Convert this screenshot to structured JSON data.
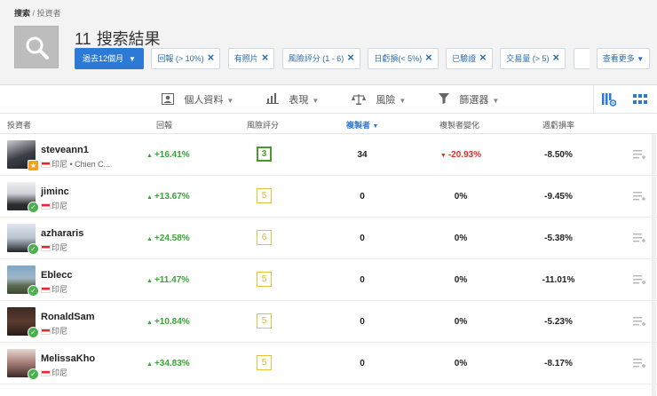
{
  "breadcrumb": {
    "root": "搜索",
    "separator": "/",
    "current": "投資者"
  },
  "results": {
    "count": "11",
    "label": "搜索結果"
  },
  "filters": {
    "period": "過去12個月",
    "chips": [
      "回報 (> 10%)",
      "有照片",
      "風險評分 (1 - 6)",
      "日虧損(< 5%)",
      "已驗證",
      "交易量 (> 5)"
    ],
    "more": "查看更多"
  },
  "view_tabs": {
    "profile": "個人資料",
    "performance": "表現",
    "risk": "風險",
    "filter": "篩選器"
  },
  "columns": {
    "investor": "投資者",
    "gain": "回報",
    "risk_score": "風險評分",
    "copiers": "複製者",
    "copiers_change": "複製者變化",
    "weekly_dd": "週虧損率"
  },
  "colors": {
    "accent": "#2d7ad6",
    "positive": "#37a634",
    "negative": "#d93025",
    "risk_low": "#e0b32f",
    "risk_mid": "#4a9a28"
  },
  "investors": [
    {
      "name": "steveann1",
      "country": "印尼 • Chien C...",
      "gain": "+16.41%",
      "risk": "3",
      "copiers": "34",
      "change": "-20.93%",
      "weekly": "-8.50%",
      "badge": "star"
    },
    {
      "name": "jiminc",
      "country": "印尼",
      "gain": "+13.67%",
      "risk": "5",
      "copiers": "0",
      "change": "0%",
      "weekly": "-9.45%",
      "badge": "check"
    },
    {
      "name": "azhararis",
      "country": "印尼",
      "gain": "+24.58%",
      "risk": "6",
      "copiers": "0",
      "change": "0%",
      "weekly": "-5.38%",
      "badge": "check"
    },
    {
      "name": "Eblecc",
      "country": "印尼",
      "gain": "+11.47%",
      "risk": "5",
      "copiers": "0",
      "change": "0%",
      "weekly": "-11.01%",
      "badge": "check"
    },
    {
      "name": "RonaldSam",
      "country": "印尼",
      "gain": "+10.84%",
      "risk": "5",
      "copiers": "0",
      "change": "0%",
      "weekly": "-5.23%",
      "badge": "check"
    },
    {
      "name": "MelissaKho",
      "country": "印尼",
      "gain": "+34.83%",
      "risk": "5",
      "copiers": "0",
      "change": "0%",
      "weekly": "-8.17%",
      "badge": "check"
    }
  ]
}
